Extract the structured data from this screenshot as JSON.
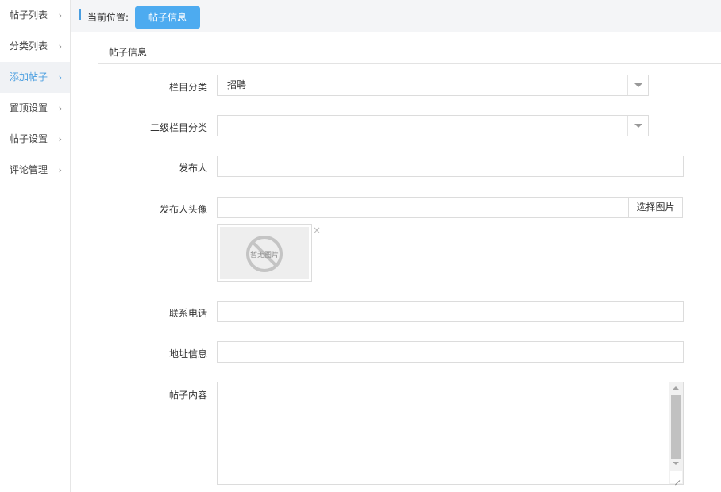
{
  "sidebar": {
    "items": [
      {
        "label": "帖子列表",
        "active": false
      },
      {
        "label": "分类列表",
        "active": false
      },
      {
        "label": "添加帖子",
        "active": true
      },
      {
        "label": "置顶设置",
        "active": false
      },
      {
        "label": "帖子设置",
        "active": false
      },
      {
        "label": "评论管理",
        "active": false
      }
    ],
    "chevron": "›"
  },
  "breadcrumb": {
    "label": "当前位置:",
    "current_tab": "帖子信息"
  },
  "section": {
    "title": "帖子信息"
  },
  "form": {
    "category": {
      "label": "栏目分类",
      "value": "招聘"
    },
    "subcategory": {
      "label": "二级栏目分类",
      "value": ""
    },
    "publisher": {
      "label": "发布人",
      "value": ""
    },
    "avatar": {
      "label": "发布人头像",
      "value": "",
      "button": "选择图片",
      "placeholder_image_text": "暂无图片",
      "close": "×"
    },
    "phone": {
      "label": "联系电话",
      "value": ""
    },
    "address": {
      "label": "地址信息",
      "value": ""
    },
    "content": {
      "label": "帖子内容",
      "value": ""
    }
  },
  "colors": {
    "accent": "#4dabf0",
    "active_text": "#4a9ee0"
  }
}
